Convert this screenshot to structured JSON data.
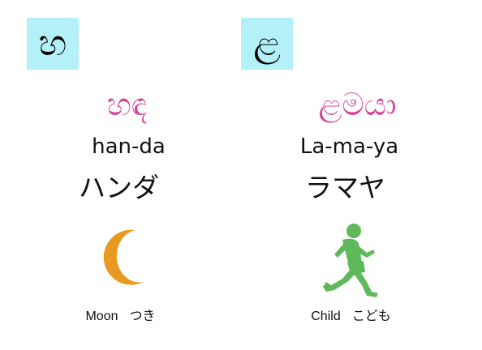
{
  "cards": [
    {
      "letter": "හ",
      "word": "හඳ",
      "romanized": "han-da",
      "katakana": "ハンダ",
      "caption_en": "Moon",
      "caption_jp": "つき",
      "icon": "moon-icon",
      "icon_color": "#e89a22"
    },
    {
      "letter": "ළ",
      "word": "ළමයා",
      "romanized": "La-ma-ya",
      "katakana": "ラマヤ",
      "caption_en": "Child",
      "caption_jp": "こども",
      "icon": "running-child-icon",
      "icon_color": "#5fb85a"
    }
  ],
  "colors": {
    "letter_box_bg": "#b3f0f7",
    "word_color": "#d6449a"
  }
}
